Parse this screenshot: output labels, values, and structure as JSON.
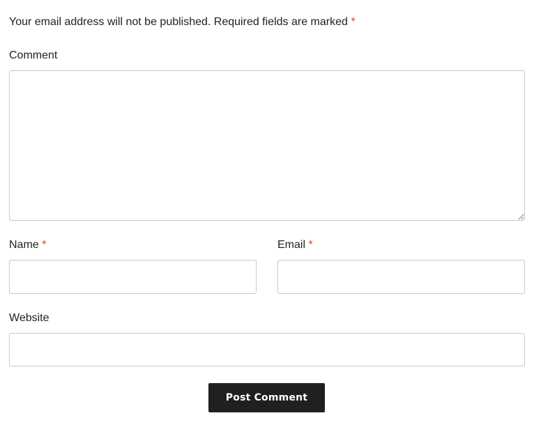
{
  "form": {
    "notes": {
      "text": "Your email address will not be published. Required fields are marked",
      "required_mark": "*"
    },
    "comment": {
      "label": "Comment",
      "value": ""
    },
    "name": {
      "label": "Name",
      "required_mark": "*",
      "value": ""
    },
    "email": {
      "label": "Email",
      "required_mark": "*",
      "value": ""
    },
    "website": {
      "label": "Website",
      "value": ""
    },
    "submit_label": "Post Comment"
  },
  "colors": {
    "required": "#e2401c",
    "button_bg": "#202020",
    "button_text": "#ffffff",
    "field_border": "#c8c8c8",
    "text": "#222222"
  }
}
